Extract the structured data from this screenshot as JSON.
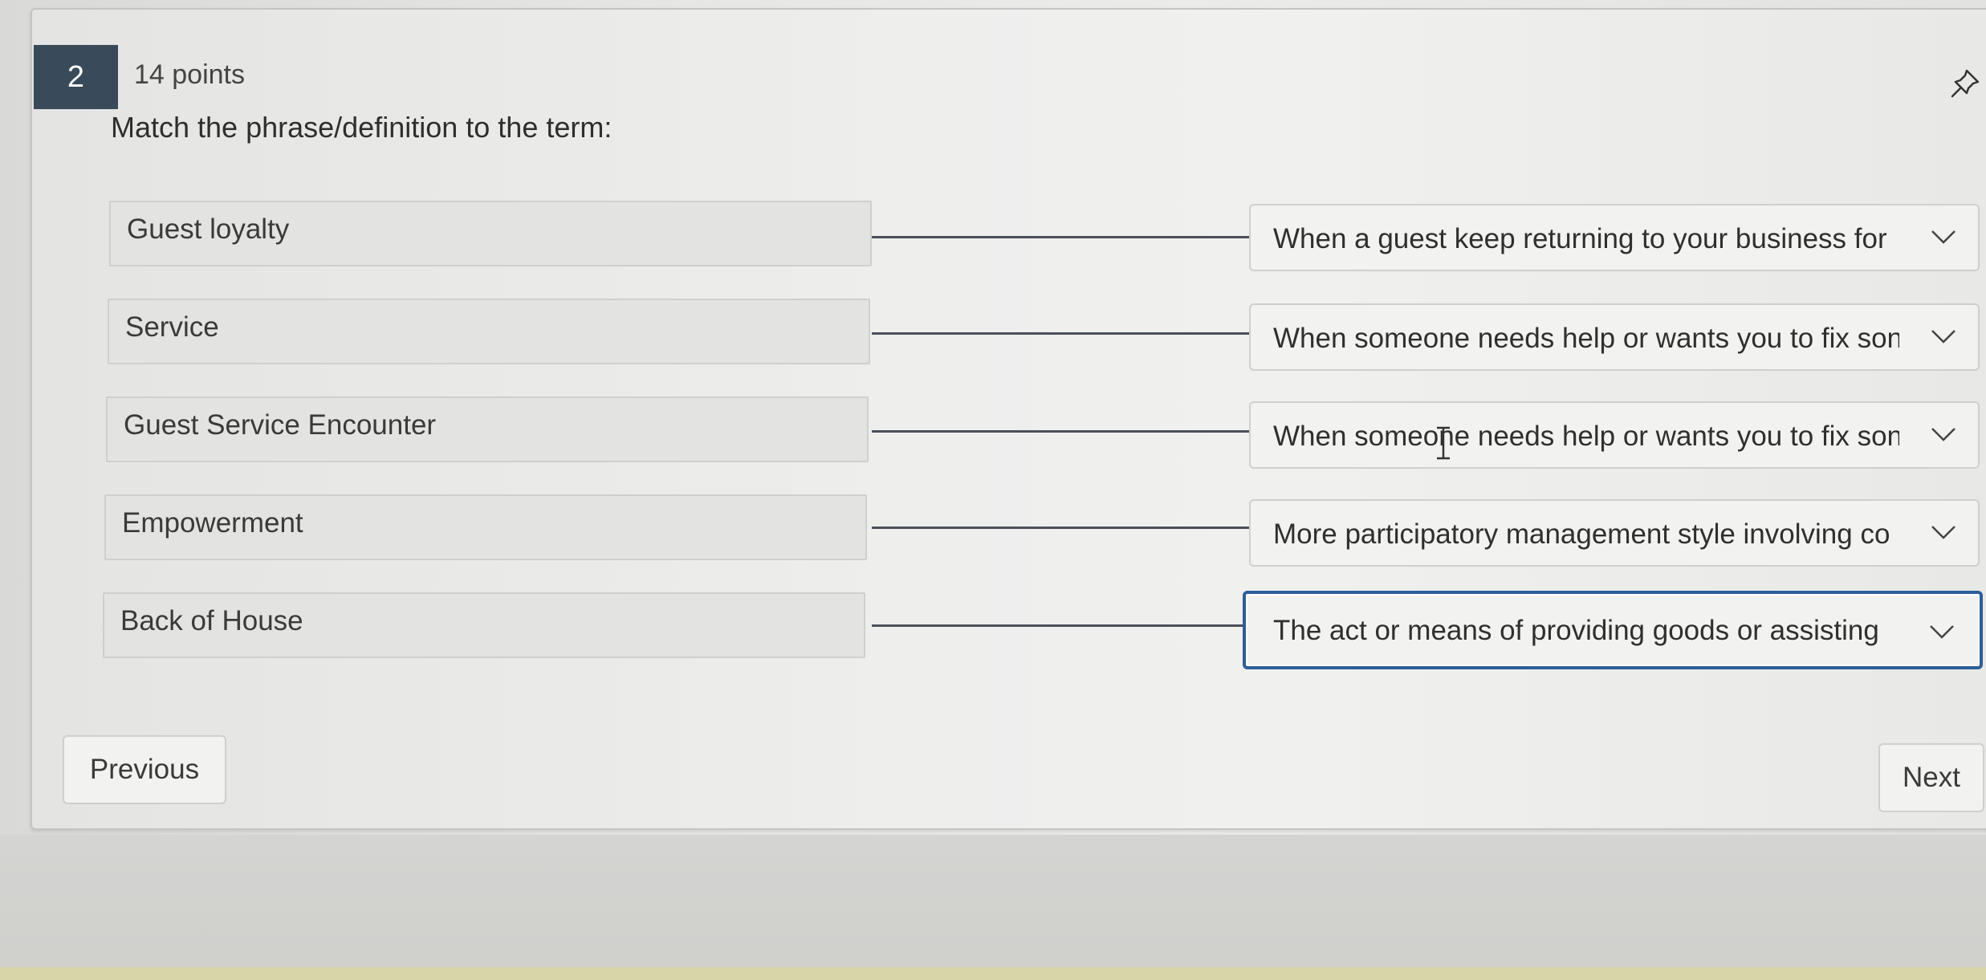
{
  "question": {
    "number": "2",
    "points": "14 points",
    "prompt": "Match the phrase/definition to the term:"
  },
  "pairs": [
    {
      "term": "Guest loyalty",
      "answer": "When a guest keep returning to your business for"
    },
    {
      "term": "Service",
      "answer": "When someone needs help or wants you to fix son"
    },
    {
      "term": "Guest Service Encounter",
      "answer": "When someone needs help or wants you to fix son"
    },
    {
      "term": "Empowerment",
      "answer": "More participatory management style involving co"
    },
    {
      "term": "Back of House",
      "answer": "The act or means of providing goods or assisting"
    }
  ],
  "navigation": {
    "previous_label": "Previous",
    "next_label": "Next"
  },
  "colors": {
    "question_badge": "#394a5a",
    "focus_outline": "#2d5e9a",
    "connector": "#4a4f5a"
  },
  "icons": {
    "pin": "pin-icon",
    "dropdown": "chevron-down-icon",
    "cursor": "text-cursor-icon"
  }
}
